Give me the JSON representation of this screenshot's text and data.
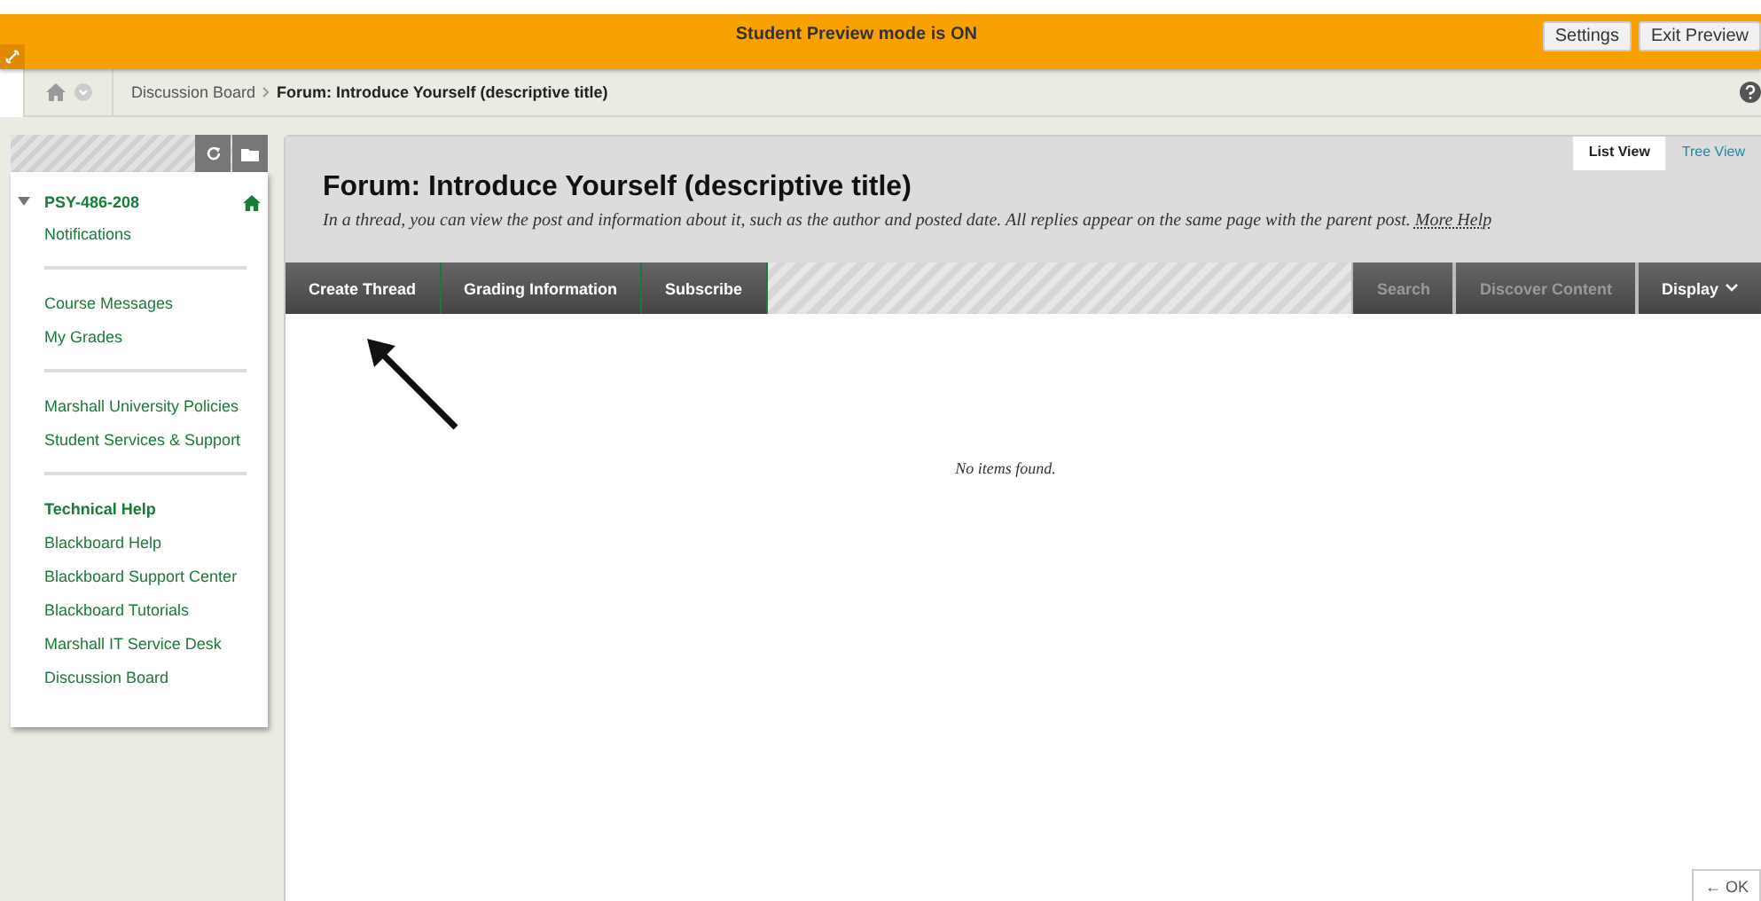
{
  "preview_bar": {
    "message": "Student Preview mode is ON",
    "buttons": [
      "Settings",
      "Exit Preview"
    ]
  },
  "breadcrumb": {
    "items": [
      "Discussion Board",
      "Forum: Introduce Yourself (descriptive title)"
    ]
  },
  "sidebar": {
    "course": {
      "label": "PSY-486-208",
      "expanded": true
    },
    "groups": [
      {
        "items": [
          {
            "label": "Notifications",
            "kind": "link"
          }
        ]
      },
      {
        "items": [
          {
            "label": "Course Messages",
            "kind": "link"
          },
          {
            "label": "My Grades",
            "kind": "link"
          }
        ]
      },
      {
        "items": [
          {
            "label": "Marshall University Policies",
            "kind": "link"
          },
          {
            "label": "Student Services & Support",
            "kind": "link"
          }
        ]
      },
      {
        "items": [
          {
            "label": "Technical Help",
            "kind": "heading"
          },
          {
            "label": "Blackboard Help",
            "kind": "link"
          },
          {
            "label": "Blackboard Support Center",
            "kind": "link"
          },
          {
            "label": "Blackboard Tutorials",
            "kind": "link"
          },
          {
            "label": "Marshall IT Service Desk",
            "kind": "link"
          },
          {
            "label": "Discussion Board",
            "kind": "link"
          }
        ]
      }
    ]
  },
  "view_tabs": [
    {
      "label": "List View",
      "selected": true
    },
    {
      "label": "Tree View",
      "selected": false
    }
  ],
  "page_title": "Forum: Introduce Yourself (descriptive title)",
  "description": {
    "text": "In a thread, you can view the post and information about it, such as the author and posted date. All replies appear on the same page with the parent post.",
    "link": "More Help"
  },
  "action_bar": {
    "left": [
      "Create Thread",
      "Grading Information",
      "Subscribe"
    ],
    "right": [
      {
        "label": "Search",
        "kind": "plain"
      },
      {
        "label": "Discover Content",
        "kind": "plain"
      },
      {
        "label": "Display",
        "kind": "menu"
      }
    ]
  },
  "empty_message": "No items found.",
  "ok_button": "← OK"
}
